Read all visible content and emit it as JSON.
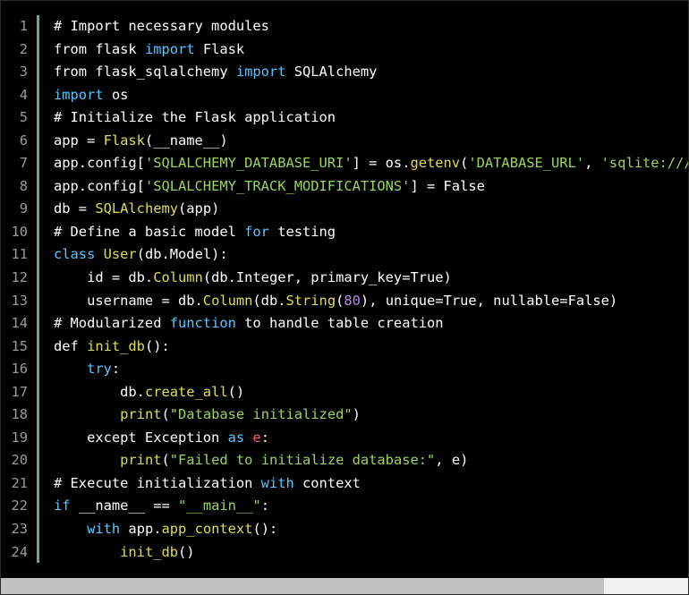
{
  "code": {
    "line_numbers": [
      "1",
      "2",
      "3",
      "4",
      "5",
      "6",
      "7",
      "8",
      "9",
      "10",
      "11",
      "12",
      "13",
      "14",
      "15",
      "16",
      "17",
      "18",
      "19",
      "20",
      "21",
      "22",
      "23",
      "24"
    ],
    "lines": [
      [
        [
          "comment",
          "# Import necessary modules"
        ]
      ],
      [
        [
          "plain",
          "from flask "
        ],
        [
          "kw",
          "import"
        ],
        [
          "plain",
          " Flask"
        ]
      ],
      [
        [
          "plain",
          "from flask_sqlalchemy "
        ],
        [
          "kw",
          "import"
        ],
        [
          "plain",
          " SQLAlchemy"
        ]
      ],
      [
        [
          "kw",
          "import"
        ],
        [
          "plain",
          " os"
        ]
      ],
      [
        [
          "comment",
          "# Initialize the Flask application"
        ]
      ],
      [
        [
          "plain",
          "app = "
        ],
        [
          "fn",
          "Flask"
        ],
        [
          "plain",
          "(__name__)"
        ]
      ],
      [
        [
          "plain",
          "app.config["
        ],
        [
          "str",
          "'SQLALCHEMY_DATABASE_URI'"
        ],
        [
          "plain",
          "] = os."
        ],
        [
          "fn",
          "getenv"
        ],
        [
          "plain",
          "("
        ],
        [
          "str",
          "'DATABASE_URL'"
        ],
        [
          "plain",
          ", "
        ],
        [
          "str",
          "'sqlite:///"
        ]
      ],
      [
        [
          "plain",
          "app.config["
        ],
        [
          "str",
          "'SQLALCHEMY_TRACK_MODIFICATIONS'"
        ],
        [
          "plain",
          "] = False"
        ]
      ],
      [
        [
          "plain",
          "db = "
        ],
        [
          "fn",
          "SQLAlchemy"
        ],
        [
          "plain",
          "(app)"
        ]
      ],
      [
        [
          "plain",
          "# Define a basic model "
        ],
        [
          "kw",
          "for"
        ],
        [
          "plain",
          " testing"
        ]
      ],
      [
        [
          "kw",
          "class"
        ],
        [
          "plain",
          " "
        ],
        [
          "fn",
          "User"
        ],
        [
          "plain",
          "(db.Model):"
        ]
      ],
      [
        [
          "plain",
          "    id = db."
        ],
        [
          "fn",
          "Column"
        ],
        [
          "plain",
          "(db.Integer, primary_key=True)"
        ]
      ],
      [
        [
          "plain",
          "    username = db."
        ],
        [
          "fn",
          "Column"
        ],
        [
          "plain",
          "(db."
        ],
        [
          "fn",
          "String"
        ],
        [
          "plain",
          "("
        ],
        [
          "num",
          "80"
        ],
        [
          "plain",
          "), unique=True, nullable=False)"
        ]
      ],
      [
        [
          "plain",
          "# Modularized "
        ],
        [
          "kw",
          "function"
        ],
        [
          "plain",
          " to handle table creation"
        ]
      ],
      [
        [
          "plain",
          "def "
        ],
        [
          "fn",
          "init_db"
        ],
        [
          "plain",
          "():"
        ]
      ],
      [
        [
          "plain",
          "    "
        ],
        [
          "kw",
          "try"
        ],
        [
          "plain",
          ":"
        ]
      ],
      [
        [
          "plain",
          "        db."
        ],
        [
          "fn",
          "create_all"
        ],
        [
          "plain",
          "()"
        ]
      ],
      [
        [
          "plain",
          "        "
        ],
        [
          "fn",
          "print"
        ],
        [
          "plain",
          "("
        ],
        [
          "str",
          "\"Database initialized\""
        ],
        [
          "plain",
          ")"
        ]
      ],
      [
        [
          "plain",
          "    except Exception "
        ],
        [
          "kw",
          "as"
        ],
        [
          "plain",
          " "
        ],
        [
          "err",
          "e"
        ],
        [
          "plain",
          ":"
        ]
      ],
      [
        [
          "plain",
          "        "
        ],
        [
          "fn",
          "print"
        ],
        [
          "plain",
          "("
        ],
        [
          "str",
          "\"Failed to initialize database:\""
        ],
        [
          "plain",
          ", e)"
        ]
      ],
      [
        [
          "plain",
          "# Execute initialization "
        ],
        [
          "kw",
          "with"
        ],
        [
          "plain",
          " context"
        ]
      ],
      [
        [
          "kw",
          "if"
        ],
        [
          "plain",
          " __name__ == "
        ],
        [
          "str",
          "\"__main__\""
        ],
        [
          "plain",
          ":"
        ]
      ],
      [
        [
          "plain",
          "    "
        ],
        [
          "kw",
          "with"
        ],
        [
          "plain",
          " app."
        ],
        [
          "fn",
          "app_context"
        ],
        [
          "plain",
          "():"
        ]
      ],
      [
        [
          "plain",
          "        "
        ],
        [
          "fn",
          "init_db"
        ],
        [
          "plain",
          "()"
        ]
      ]
    ]
  },
  "colors": {
    "background": "#000000",
    "gutter_rule": "#5fae85",
    "keyword": "#57c7ff",
    "function": "#dede52",
    "string": "#9cd25e",
    "number": "#b88cf0",
    "error": "#ff5566"
  },
  "scrollbar": {
    "horizontal_position_fraction": 0.0
  }
}
